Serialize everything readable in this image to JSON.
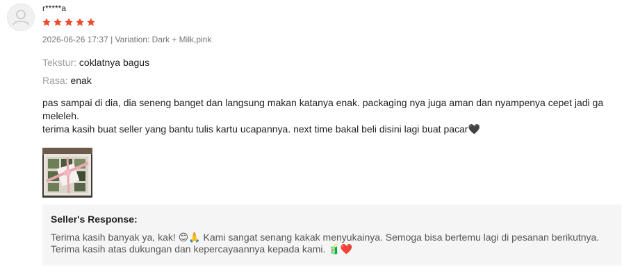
{
  "review": {
    "username": "r*****a",
    "rating": 5,
    "rating_max": 5,
    "star_color": "#ee4d2d",
    "meta": "2026-06-26 17:37 | Variation: Dark + Milk,pink",
    "attributes": [
      {
        "label": "Tekstur:",
        "value": "coklatnya bagus"
      },
      {
        "label": "Rasa:",
        "value": "enak"
      }
    ],
    "comment_lines": [
      "pas sampai di dia, dia seneng banget dan langsung makan katanya enak. packaging nya juga aman dan nyampenya cepet jadi ga meleleh.",
      "terima kasih buat seller yang bantu tulis kartu ucapannya. next time bakal beli disini lagi buat pacar🖤"
    ],
    "photo_icon": "chocolate-box-photo"
  },
  "seller_response": {
    "title": "Seller's Response:",
    "lines": [
      "Terima kasih banyak ya, kak! 😊🙏 Kami sangat senang kakak menyukainya. Semoga bisa bertemu lagi di pesanan berikutnya.",
      "Terima kasih atas dukungan dan kepercayaannya kepada kami. 🧃❤️"
    ]
  }
}
